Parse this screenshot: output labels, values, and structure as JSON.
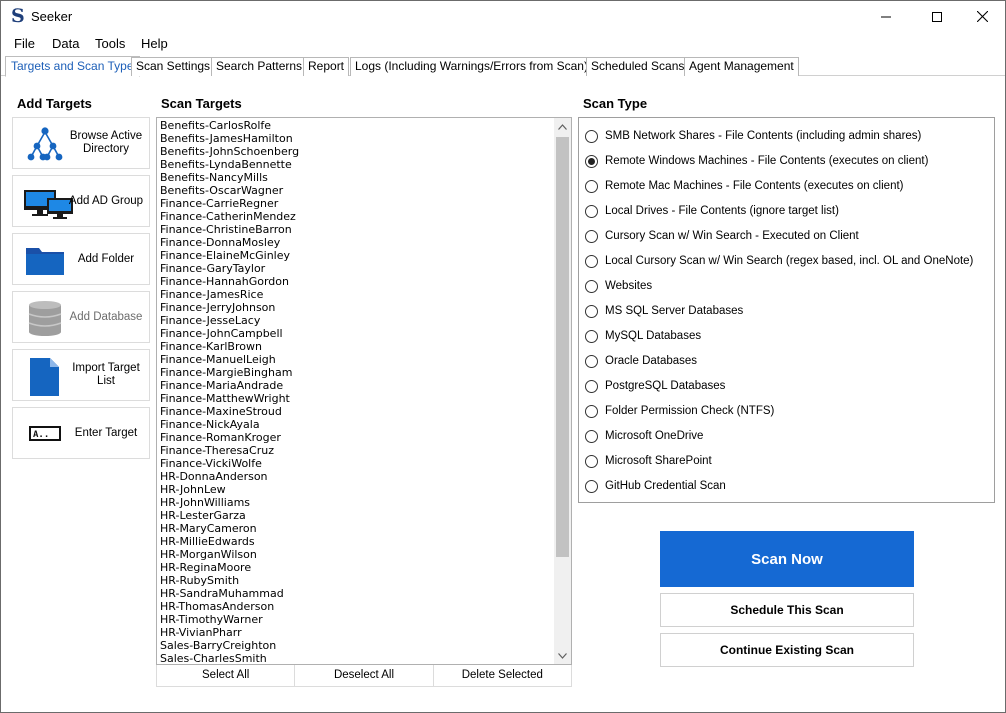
{
  "window": {
    "title": "Seeker",
    "app_icon_glyph": "S",
    "controls": [
      "minimize-icon",
      "maximize-icon",
      "close-icon"
    ]
  },
  "menu": [
    "File",
    "Data",
    "Tools",
    "Help"
  ],
  "tabs": [
    {
      "label": "Targets and Scan Type",
      "active": true
    },
    {
      "label": "Scan Settings",
      "active": false
    },
    {
      "label": "Search Patterns",
      "active": false
    },
    {
      "label": "Report",
      "active": false
    },
    {
      "label": "Logs (Including Warnings/Errors from Scan)",
      "active": false
    },
    {
      "label": "Scheduled Scans",
      "active": false
    },
    {
      "label": "Agent Management",
      "active": false
    }
  ],
  "add_targets": {
    "title": "Add Targets",
    "buttons": [
      {
        "label": "Browse Active Directory",
        "icon": "org-chart-icon",
        "enabled": true
      },
      {
        "label": "Add AD Group",
        "icon": "computers-icon",
        "enabled": true
      },
      {
        "label": "Add Folder",
        "icon": "folder-icon",
        "enabled": true
      },
      {
        "label": "Add Database",
        "icon": "database-icon",
        "enabled": false
      },
      {
        "label": "Import Target List",
        "icon": "document-icon",
        "enabled": true
      },
      {
        "label": "Enter Target",
        "icon": "text-field-icon",
        "enabled": true
      }
    ]
  },
  "scan_targets": {
    "title": "Scan Targets",
    "items": [
      "Benefits-CarlosRolfe",
      "Benefits-JamesHamilton",
      "Benefits-JohnSchoenberg",
      "Benefits-LyndaBennette",
      "Benefits-NancyMills",
      "Benefits-OscarWagner",
      "Finance-CarrieRegner",
      "Finance-CatherinMendez",
      "Finance-ChristineBarron",
      "Finance-DonnaMosley",
      "Finance-ElaineMcGinley",
      "Finance-GaryTaylor",
      "Finance-HannahGordon",
      "Finance-JamesRice",
      "Finance-JerryJohnson",
      "Finance-JesseLacy",
      "Finance-JohnCampbell",
      "Finance-KarlBrown",
      "Finance-ManuelLeigh",
      "Finance-MargieBingham",
      "Finance-MariaAndrade",
      "Finance-MatthewWright",
      "Finance-MaxineStroud",
      "Finance-NickAyala",
      "Finance-RomanKroger",
      "Finance-TheresaCruz",
      "Finance-VickiWolfe",
      "HR-DonnaAnderson",
      "HR-JohnLew",
      "HR-JohnWilliams",
      "HR-LesterGarza",
      "HR-MaryCameron",
      "HR-MillieEdwards",
      "HR-MorganWilson",
      "HR-ReginaMoore",
      "HR-RubySmith",
      "HR-SandraMuhammad",
      "HR-ThomasAnderson",
      "HR-TimothyWarner",
      "HR-VivianPharr",
      "Sales-BarryCreighton",
      "Sales-CharlesSmith"
    ],
    "actions": [
      "Select All",
      "Deselect All",
      "Delete Selected"
    ]
  },
  "scan_type": {
    "title": "Scan Type",
    "selected_index": 1,
    "options": [
      "SMB Network Shares - File Contents (including admin shares)",
      "Remote Windows Machines - File Contents (executes on client)",
      "Remote Mac Machines - File Contents (executes on client)",
      "Local Drives - File Contents (ignore target list)",
      "Cursory Scan w/ Win Search - Executed on Client",
      "Local Cursory Scan w/ Win Search (regex based, incl. OL and OneNote)",
      "Websites",
      "MS SQL Server Databases",
      "MySQL Databases",
      "Oracle Databases",
      "PostgreSQL Databases",
      "Folder Permission Check (NTFS)",
      "Microsoft OneDrive",
      "Microsoft SharePoint",
      "GitHub Credential Scan"
    ]
  },
  "actions": {
    "scan_now": "Scan Now",
    "schedule": "Schedule This Scan",
    "continue": "Continue Existing Scan"
  },
  "colors": {
    "accent": "#1569d3",
    "active_tab_text": "#1d5fb8",
    "icon_blue": "#1565c0"
  }
}
